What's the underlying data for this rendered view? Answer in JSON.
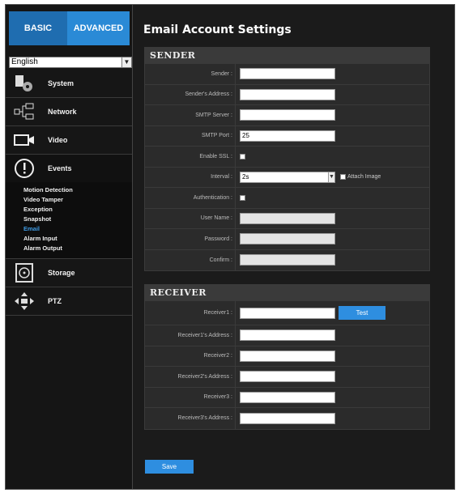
{
  "tabs": {
    "basic": "BASIC",
    "advanced": "ADVANCED"
  },
  "language": {
    "value": "English"
  },
  "menu": {
    "system": "System",
    "network": "Network",
    "video": "Video",
    "events": "Events",
    "storage": "Storage",
    "ptz": "PTZ"
  },
  "events_submenu": [
    "Motion Detection",
    "Video Tamper",
    "Exception",
    "Snapshot",
    "Email",
    "Alarm Input",
    "Alarm Output"
  ],
  "page_title": "Email Account Settings",
  "sender": {
    "heading": "SENDER",
    "sender_label": "Sender :",
    "address_label": "Sender's Address :",
    "smtp_server_label": "SMTP Server :",
    "smtp_port_label": "SMTP Port :",
    "smtp_port_value": "25",
    "ssl_label": "Enable SSL :",
    "interval_label": "Interval :",
    "interval_value": "2s",
    "attach_label": "Attach Image",
    "auth_label": "Authentication :",
    "username_label": "User Name :",
    "password_label": "Password :",
    "confirm_label": "Confirm :"
  },
  "receiver": {
    "heading": "RECEIVER",
    "r1_label": "Receiver1 :",
    "test_button": "Test",
    "r1_addr_label": "Receiver1's Address :",
    "r2_label": "Receiver2 :",
    "r2_addr_label": "Receiver2's Address :",
    "r3_label": "Receiver3 :",
    "r3_addr_label": "Receiver3's Address :"
  },
  "save_button": "Save",
  "colors": {
    "accent": "#2e8ee0",
    "active_submenu": "#3f9be3"
  }
}
